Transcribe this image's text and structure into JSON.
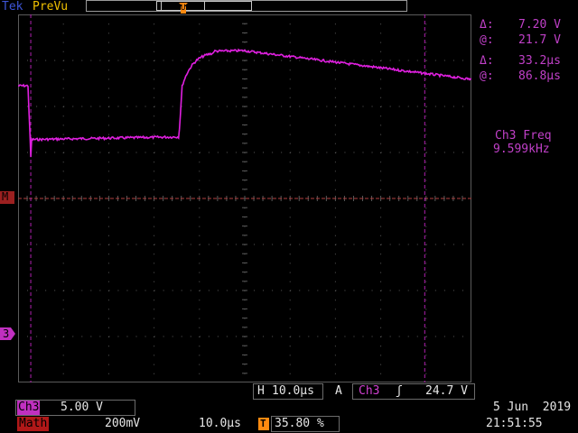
{
  "header": {
    "brand": "Tek",
    "mode": "PreVu",
    "trigger_pos_marker": "U",
    "trigger_marker": "T"
  },
  "markers": {
    "math_marker": "M",
    "ch3_marker": "3",
    "ch3_level_arrow": "◂"
  },
  "cursors": {
    "delta_v_symbol": "Δ:",
    "delta_v": "7.20 V",
    "at_v_symbol": "@:",
    "at_v": "21.7 V",
    "delta_t_symbol": "Δ:",
    "delta_t": "33.2µs",
    "at_t_symbol": "@:",
    "at_t": "86.8µs"
  },
  "measurement": {
    "label": "Ch3 Freq",
    "value": "9.599kHz"
  },
  "bottom": {
    "horizontal_label": "H",
    "horizontal_scale": "10.0µs",
    "trigger_mode": "A",
    "trigger_source": "Ch3",
    "trigger_slope_icon": "rising-edge-icon",
    "trigger_slope_glyph": "ʃ",
    "trigger_level": "24.7 V",
    "ch3_label": "Ch3",
    "ch3_scale": "5.00 V",
    "math_label": "Math",
    "math_scale": "200mV",
    "math_time": "10.0µs",
    "trigger_pos_icon": "T",
    "trigger_pos": "35.80 %",
    "date": "5 Jun  2019",
    "time": "21:51:55"
  },
  "colors": {
    "trace": "#e020e0",
    "grid": "#5a5a5a",
    "cursor": "#b020b0",
    "math_ref": "#b04040",
    "brand": "#3d54d6",
    "trigger": "#ff8a10"
  }
}
